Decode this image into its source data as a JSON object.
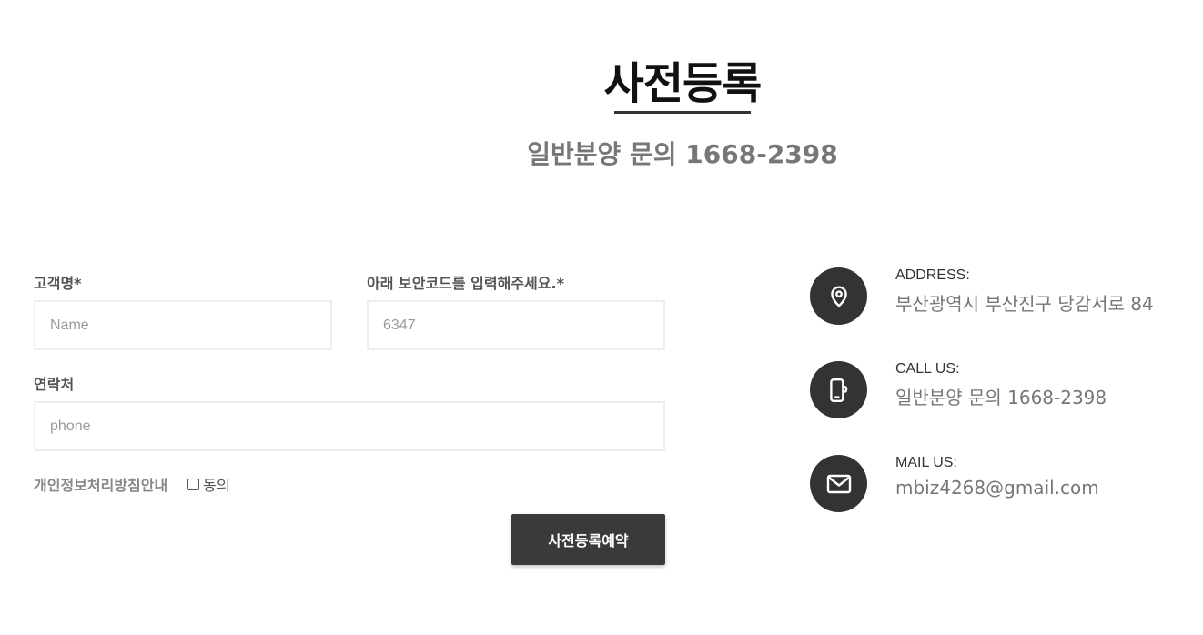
{
  "header": {
    "title": "사전등록",
    "subtitle": "일반분양 문의 1668-2398"
  },
  "form": {
    "name_label": "고객명*",
    "name_placeholder": "Name",
    "code_label": "아래 보안코드를 입력해주세요.*",
    "code_placeholder": "6347",
    "phone_label": "연락처",
    "phone_placeholder": "phone",
    "privacy_label": "개인정보처리방침안내",
    "agree_label": "동의",
    "agree_checked": false,
    "submit_label": "사전등록예약"
  },
  "contact": {
    "address": {
      "heading": "ADDRESS:",
      "value": "부산광역시 부산진구 당감서로 84",
      "icon": "location-pin-icon"
    },
    "call": {
      "heading": "CALL US:",
      "value": "일반분양 문의 1668-2398",
      "icon": "mobile-phone-icon"
    },
    "mail": {
      "heading": "MAIL US:",
      "value": "mbiz4268@gmail.com",
      "icon": "envelope-icon"
    }
  },
  "colors": {
    "accent": "#333333",
    "muted_text": "#777777",
    "input_border": "#eeeeee",
    "button_bg": "#3a3a3a"
  }
}
